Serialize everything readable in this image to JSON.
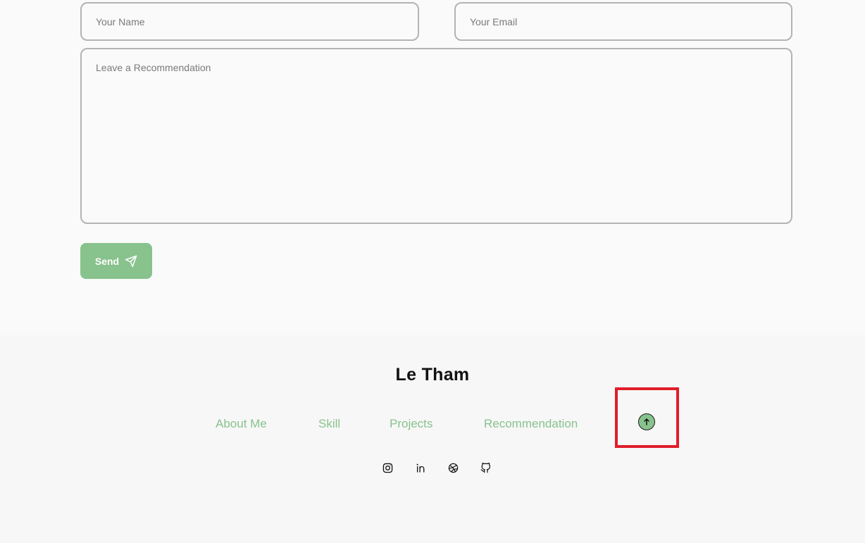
{
  "form": {
    "name_placeholder": "Your Name",
    "email_placeholder": "Your Email",
    "message_placeholder": "Leave a Recommendation",
    "send_label": "Send"
  },
  "footer": {
    "brand": "Le Tham",
    "nav": [
      {
        "label": "About Me"
      },
      {
        "label": "Skill"
      },
      {
        "label": "Projects"
      },
      {
        "label": "Recommendation"
      }
    ],
    "back_to_top_icon": "arrow-up-circle-icon",
    "social_icons": [
      "instagram-icon",
      "linkedin-icon",
      "dribbble-icon",
      "github-icon"
    ]
  },
  "colors": {
    "accent": "#88c28d",
    "highlight": "#e11d2a",
    "background": "#fafafa"
  }
}
